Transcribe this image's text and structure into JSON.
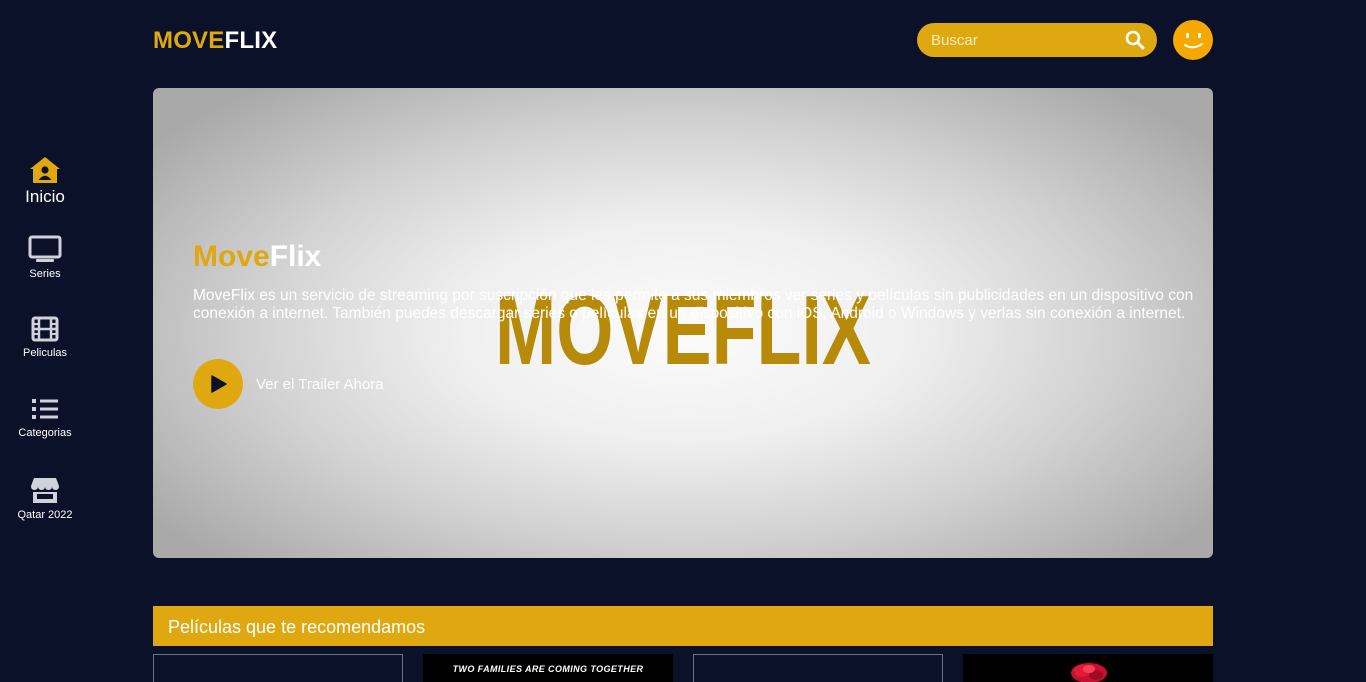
{
  "header": {
    "logo_part1": "MOVE",
    "logo_part2": "FLIX",
    "search_placeholder": "Buscar",
    "search_icon": "search-icon",
    "avatar_icon": "smiley-avatar"
  },
  "sidebar": {
    "items": [
      {
        "label": "Inicio",
        "icon": "home-user-icon",
        "active": true
      },
      {
        "label": "Series",
        "icon": "tv-icon"
      },
      {
        "label": "Peliculas",
        "icon": "film-icon"
      },
      {
        "label": "Categorias",
        "icon": "list-icon"
      },
      {
        "label": "Qatar 2022",
        "icon": "store-icon"
      }
    ]
  },
  "hero": {
    "title_part1": "Move",
    "title_part2": "Flix",
    "description": "MoveFlix es un servicio de streaming por suscripción que les permite a sus miembros ver series y películas sin publicidades en un dispositivo con conexión a internet. También puedes descargar series o películas en un dispositivo con iOS, Android o Windows y verlas sin conexión a internet.",
    "trailer_label": "Ver el Trailer Ahora",
    "background_logo_text": "MOVEFLIX"
  },
  "recommendations": {
    "title": "Películas que te recomendamos",
    "cards": [
      {
        "caption": ""
      },
      {
        "caption": "TWO FAMILIES ARE COMING TOGETHER"
      },
      {
        "caption": ""
      },
      {
        "caption": ""
      }
    ]
  },
  "colors": {
    "background": "#0a1128",
    "accent": "#e0a810",
    "text": "#ffffff"
  }
}
